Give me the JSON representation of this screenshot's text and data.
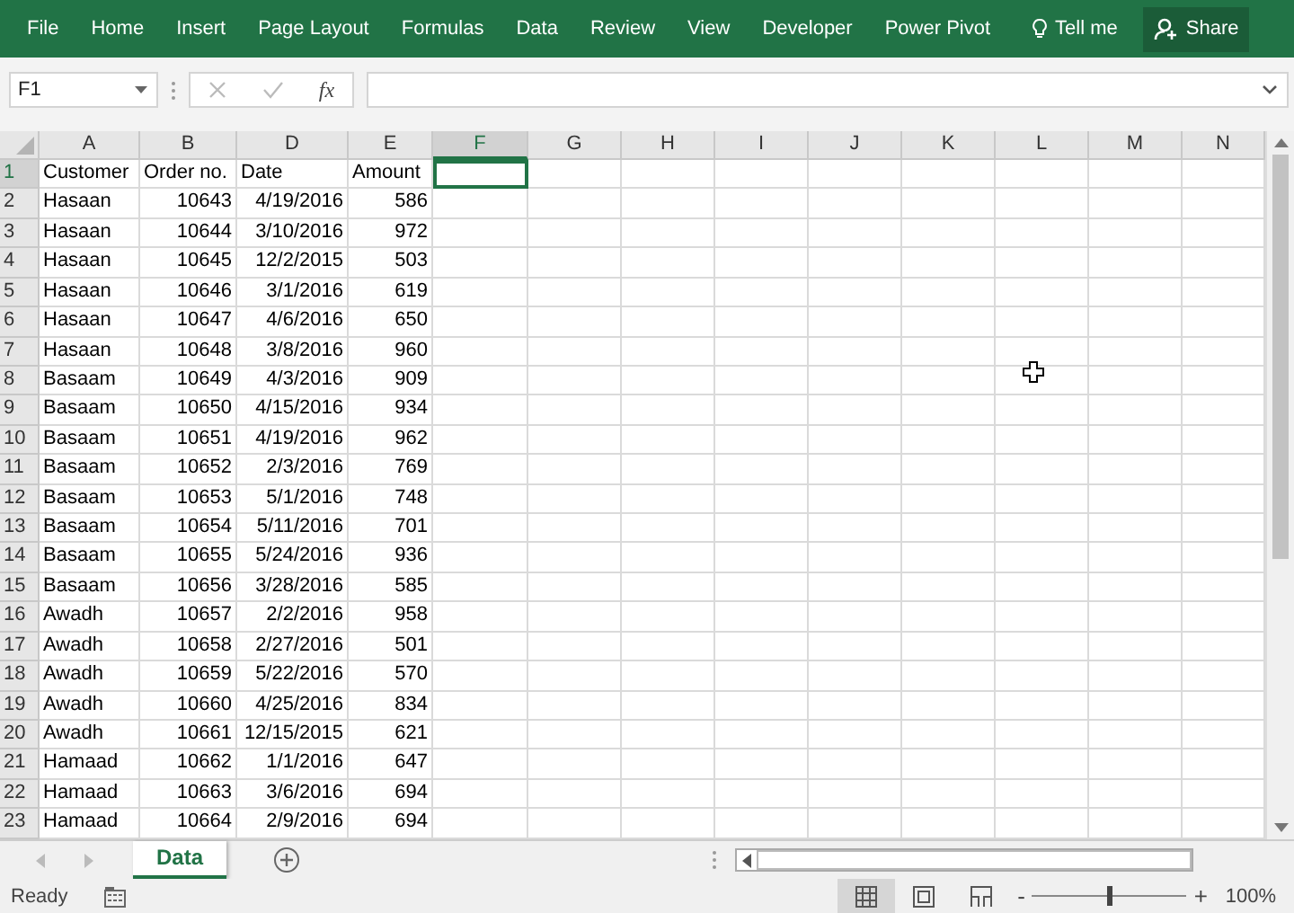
{
  "ribbon": {
    "tabs": [
      "File",
      "Home",
      "Insert",
      "Page Layout",
      "Formulas",
      "Data",
      "Review",
      "View",
      "Developer",
      "Power Pivot"
    ],
    "tell_me": "Tell me",
    "share": "Share"
  },
  "formula_bar": {
    "name_box": "F1",
    "function_label": "fx"
  },
  "columns": [
    {
      "label": "A",
      "selected": false
    },
    {
      "label": "B",
      "selected": false
    },
    {
      "label": "D",
      "selected": false
    },
    {
      "label": "E",
      "selected": false
    },
    {
      "label": "F",
      "selected": true
    },
    {
      "label": "G",
      "selected": false
    },
    {
      "label": "H",
      "selected": false
    },
    {
      "label": "I",
      "selected": false
    },
    {
      "label": "J",
      "selected": false
    },
    {
      "label": "K",
      "selected": false
    },
    {
      "label": "L",
      "selected": false
    },
    {
      "label": "M",
      "selected": false
    },
    {
      "label": "N",
      "selected": false
    }
  ],
  "rows": [
    {
      "number": "1",
      "kind": "header",
      "selected": true,
      "cells": [
        "Customer",
        "Order no.",
        "Date",
        "Amount"
      ]
    },
    {
      "number": "2",
      "kind": "data",
      "selected": false,
      "cells": [
        "Hasaan",
        "10643",
        "4/19/2016",
        "586"
      ]
    },
    {
      "number": "3",
      "kind": "data",
      "selected": false,
      "cells": [
        "Hasaan",
        "10644",
        "3/10/2016",
        "972"
      ]
    },
    {
      "number": "4",
      "kind": "data",
      "selected": false,
      "cells": [
        "Hasaan",
        "10645",
        "12/2/2015",
        "503"
      ]
    },
    {
      "number": "5",
      "kind": "data",
      "selected": false,
      "cells": [
        "Hasaan",
        "10646",
        "3/1/2016",
        "619"
      ]
    },
    {
      "number": "6",
      "kind": "data",
      "selected": false,
      "cells": [
        "Hasaan",
        "10647",
        "4/6/2016",
        "650"
      ]
    },
    {
      "number": "7",
      "kind": "data",
      "selected": false,
      "cells": [
        "Hasaan",
        "10648",
        "3/8/2016",
        "960"
      ]
    },
    {
      "number": "8",
      "kind": "data",
      "selected": false,
      "cells": [
        "Basaam",
        "10649",
        "4/3/2016",
        "909"
      ]
    },
    {
      "number": "9",
      "kind": "data",
      "selected": false,
      "cells": [
        "Basaam",
        "10650",
        "4/15/2016",
        "934"
      ]
    },
    {
      "number": "10",
      "kind": "data",
      "selected": false,
      "cells": [
        "Basaam",
        "10651",
        "4/19/2016",
        "962"
      ]
    },
    {
      "number": "11",
      "kind": "data",
      "selected": false,
      "cells": [
        "Basaam",
        "10652",
        "2/3/2016",
        "769"
      ]
    },
    {
      "number": "12",
      "kind": "data",
      "selected": false,
      "cells": [
        "Basaam",
        "10653",
        "5/1/2016",
        "748"
      ]
    },
    {
      "number": "13",
      "kind": "data",
      "selected": false,
      "cells": [
        "Basaam",
        "10654",
        "5/11/2016",
        "701"
      ]
    },
    {
      "number": "14",
      "kind": "data",
      "selected": false,
      "cells": [
        "Basaam",
        "10655",
        "5/24/2016",
        "936"
      ]
    },
    {
      "number": "15",
      "kind": "data",
      "selected": false,
      "cells": [
        "Basaam",
        "10656",
        "3/28/2016",
        "585"
      ]
    },
    {
      "number": "16",
      "kind": "data",
      "selected": false,
      "cells": [
        "Awadh",
        "10657",
        "2/2/2016",
        "958"
      ]
    },
    {
      "number": "17",
      "kind": "data",
      "selected": false,
      "cells": [
        "Awadh",
        "10658",
        "2/27/2016",
        "501"
      ]
    },
    {
      "number": "18",
      "kind": "data",
      "selected": false,
      "cells": [
        "Awadh",
        "10659",
        "5/22/2016",
        "570"
      ]
    },
    {
      "number": "19",
      "kind": "data",
      "selected": false,
      "cells": [
        "Awadh",
        "10660",
        "4/25/2016",
        "834"
      ]
    },
    {
      "number": "20",
      "kind": "data",
      "selected": false,
      "cells": [
        "Awadh",
        "10661",
        "12/15/2015",
        "621"
      ]
    },
    {
      "number": "21",
      "kind": "data",
      "selected": false,
      "cells": [
        "Hamaad",
        "10662",
        "1/1/2016",
        "647"
      ]
    },
    {
      "number": "22",
      "kind": "data",
      "selected": false,
      "cells": [
        "Hamaad",
        "10663",
        "3/6/2016",
        "694"
      ]
    },
    {
      "number": "23",
      "kind": "data",
      "selected": false,
      "cells": [
        "Hamaad",
        "10664",
        "2/9/2016",
        "694"
      ]
    }
  ],
  "sheet_tabs": [
    {
      "label": "Data",
      "selected": true
    }
  ],
  "status_bar": {
    "status": "Ready",
    "zoom": "100%",
    "level": 0.5,
    "minus": "-",
    "plus": "+"
  }
}
